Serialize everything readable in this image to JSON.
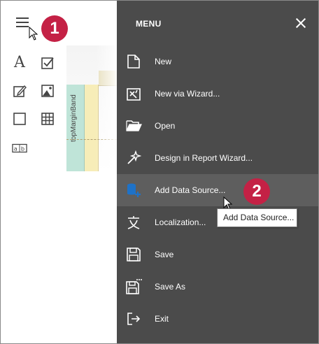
{
  "badges": {
    "step1": "1",
    "step2": "2"
  },
  "designer": {
    "band_label": "topMarginBand"
  },
  "menu": {
    "title": "MENU",
    "items": [
      {
        "label": "New",
        "icon": "new-file-icon"
      },
      {
        "label": "New via Wizard...",
        "icon": "wizard-icon"
      },
      {
        "label": "Open",
        "icon": "folder-open-icon"
      },
      {
        "label": "Design in Report Wizard...",
        "icon": "magic-wand-icon"
      },
      {
        "label": "Add Data Source...",
        "icon": "database-add-icon"
      },
      {
        "label": "Localization...",
        "icon": "translate-icon"
      },
      {
        "label": "Save",
        "icon": "save-icon"
      },
      {
        "label": "Save As",
        "icon": "save-as-icon"
      },
      {
        "label": "Exit",
        "icon": "exit-icon"
      }
    ]
  },
  "tooltip": {
    "text": "Add Data Source..."
  },
  "toolbox": {
    "items": [
      "label-icon",
      "checkbox-icon",
      "edit-icon",
      "picture-icon",
      "panel-icon",
      "table-icon",
      "character-comb-icon"
    ],
    "label_glyph": "A"
  },
  "colors": {
    "menu_bg": "#4b4b4b",
    "menu_hover": "#5e5e5e",
    "badge": "#c42145",
    "accent_blue": "#1e72c8"
  }
}
